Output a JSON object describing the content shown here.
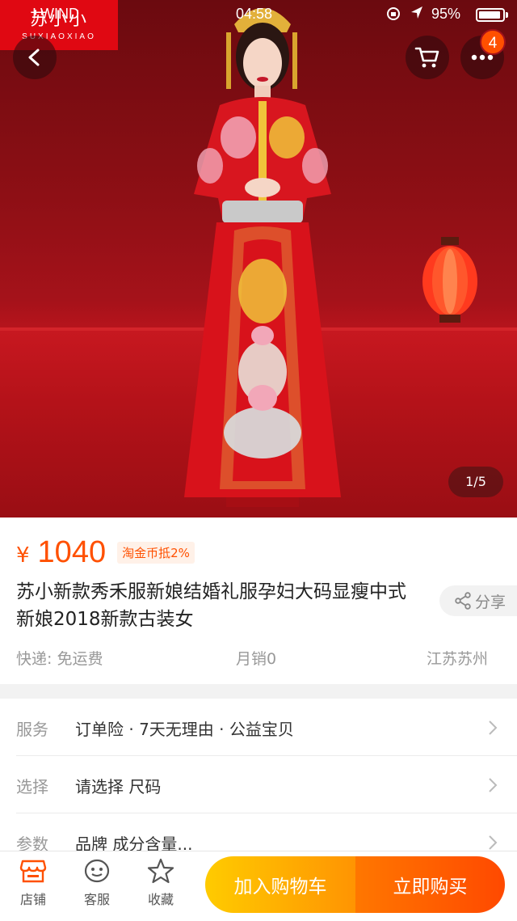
{
  "status_bar": {
    "carrier": "I WIND",
    "time": "04:58",
    "battery": "95%"
  },
  "brand": {
    "logo_cn": "苏小小",
    "logo_en": "SUXIAOXIAO"
  },
  "header": {
    "cart_badge": "4"
  },
  "gallery": {
    "pager": "1/5"
  },
  "product": {
    "currency": "¥",
    "price": "1040",
    "coin_discount": "淘金币抵2%",
    "title": "苏小新款秀禾服新娘结婚礼服孕妇大码显瘦中式新娘2018新款古装女",
    "share_label": "分享",
    "shipping": "快递: 免运费",
    "monthly_sales": "月销0",
    "location": "江苏苏州"
  },
  "options": [
    {
      "label": "服务",
      "value": "订单险 · 7天无理由 · 公益宝贝"
    },
    {
      "label": "选择",
      "value": "请选择 尺码"
    },
    {
      "label": "参数",
      "value": "品牌 成分含量..."
    }
  ],
  "bottom_bar": {
    "shop": "店铺",
    "service": "客服",
    "favorite": "收藏",
    "add_to_cart": "加入购物车",
    "buy_now": "立即购买"
  },
  "colors": {
    "accent": "#ff5000",
    "brand_red": "#e00812",
    "cart_button": "#ffa800",
    "buy_button": "#ff5a00"
  }
}
